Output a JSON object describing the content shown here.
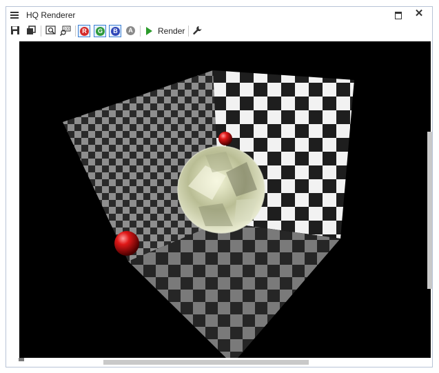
{
  "window": {
    "title": "HQ Renderer"
  },
  "toolbar": {
    "buttons": [
      {
        "name": "save-icon"
      },
      {
        "name": "copy-icon"
      },
      {
        "name": "zoom-fit-icon"
      },
      {
        "name": "zoom-100-icon"
      }
    ],
    "channels": [
      {
        "label": "R",
        "color": "#d42a2a",
        "active": true
      },
      {
        "label": "G",
        "color": "#2e9a3b",
        "active": true
      },
      {
        "label": "B",
        "color": "#2f47b8",
        "active": true
      },
      {
        "label": "A",
        "color": "#8a8a8a",
        "active": false
      }
    ],
    "render_label": "Render",
    "play_color": "#2a9a2a",
    "settings_icon": "wrench-icon"
  },
  "scene": {
    "background": "#000000",
    "objects": [
      "checker-room",
      "glass-sphere",
      "red-sphere-small",
      "red-sphere-large"
    ]
  }
}
